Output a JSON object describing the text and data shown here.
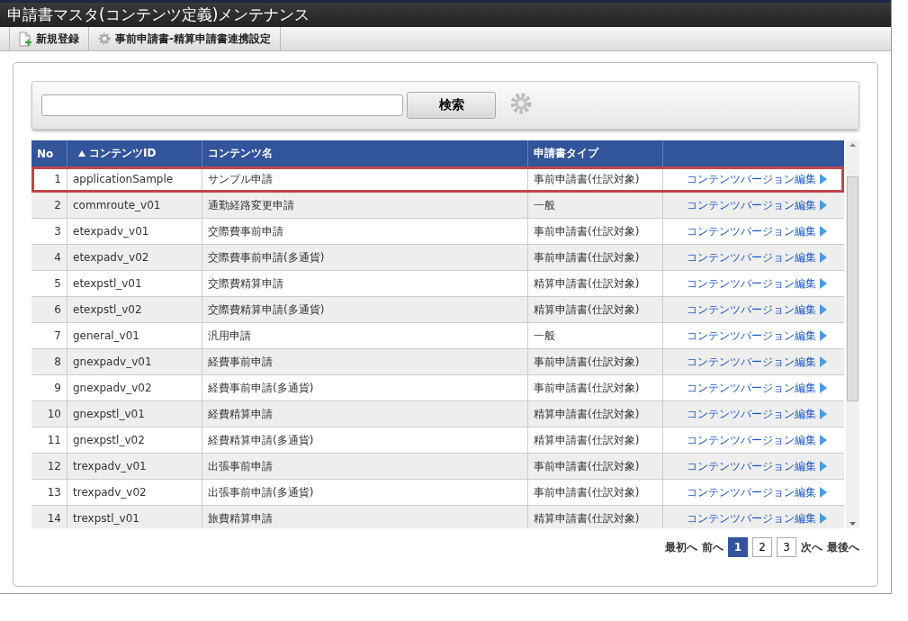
{
  "window": {
    "title": "申請書マスタ(コンテンツ定義)メンテナンス"
  },
  "toolbar": [
    {
      "label": "新規登録"
    },
    {
      "label": "事前申請書-精算申請書連携設定"
    }
  ],
  "search": {
    "button": "検索"
  },
  "table": {
    "columns": [
      {
        "label": "No",
        "sorted": false
      },
      {
        "label": "コンテンツID",
        "sorted": true
      },
      {
        "label": "コンテンツ名",
        "sorted": false
      },
      {
        "label": "申請書タイプ",
        "sorted": false
      }
    ],
    "rows": [
      {
        "no": "1",
        "id": "applicationSample",
        "name": "サンプル申請",
        "type": "事前申請書(仕訳対象)",
        "link": "コンテンツバージョン編集",
        "highlighted": true
      },
      {
        "no": "2",
        "id": "commroute_v01",
        "name": "通勤経路変更申請",
        "type": "一般",
        "link": "コンテンツバージョン編集",
        "highlighted": false
      },
      {
        "no": "3",
        "id": "etexpadv_v01",
        "name": "交際費事前申請",
        "type": "事前申請書(仕訳対象)",
        "link": "コンテンツバージョン編集",
        "highlighted": false
      },
      {
        "no": "4",
        "id": "etexpadv_v02",
        "name": "交際費事前申請(多通貨)",
        "type": "事前申請書(仕訳対象)",
        "link": "コンテンツバージョン編集",
        "highlighted": false
      },
      {
        "no": "5",
        "id": "etexpstl_v01",
        "name": "交際費精算申請",
        "type": "精算申請書(仕訳対象)",
        "link": "コンテンツバージョン編集",
        "highlighted": false
      },
      {
        "no": "6",
        "id": "etexpstl_v02",
        "name": "交際費精算申請(多通貨)",
        "type": "精算申請書(仕訳対象)",
        "link": "コンテンツバージョン編集",
        "highlighted": false
      },
      {
        "no": "7",
        "id": "general_v01",
        "name": "汎用申請",
        "type": "一般",
        "link": "コンテンツバージョン編集",
        "highlighted": false
      },
      {
        "no": "8",
        "id": "gnexpadv_v01",
        "name": "経費事前申請",
        "type": "事前申請書(仕訳対象)",
        "link": "コンテンツバージョン編集",
        "highlighted": false
      },
      {
        "no": "9",
        "id": "gnexpadv_v02",
        "name": "経費事前申請(多通貨)",
        "type": "事前申請書(仕訳対象)",
        "link": "コンテンツバージョン編集",
        "highlighted": false
      },
      {
        "no": "10",
        "id": "gnexpstl_v01",
        "name": "経費精算申請",
        "type": "精算申請書(仕訳対象)",
        "link": "コンテンツバージョン編集",
        "highlighted": false
      },
      {
        "no": "11",
        "id": "gnexpstl_v02",
        "name": "経費精算申請(多通貨)",
        "type": "精算申請書(仕訳対象)",
        "link": "コンテンツバージョン編集",
        "highlighted": false
      },
      {
        "no": "12",
        "id": "trexpadv_v01",
        "name": "出張事前申請",
        "type": "事前申請書(仕訳対象)",
        "link": "コンテンツバージョン編集",
        "highlighted": false
      },
      {
        "no": "13",
        "id": "trexpadv_v02",
        "name": "出張事前申請(多通貨)",
        "type": "事前申請書(仕訳対象)",
        "link": "コンテンツバージョン編集",
        "highlighted": false
      },
      {
        "no": "14",
        "id": "trexpstl_v01",
        "name": "旅費精算申請",
        "type": "精算申請書(仕訳対象)",
        "link": "コンテンツバージョン編集",
        "highlighted": false
      }
    ]
  },
  "pagination": {
    "first": "最初へ",
    "prev": "前へ",
    "pages": [
      {
        "label": "1",
        "selected": true
      },
      {
        "label": "2",
        "selected": false
      },
      {
        "label": "3",
        "selected": false
      }
    ],
    "next": "次へ",
    "last": "最後へ"
  }
}
